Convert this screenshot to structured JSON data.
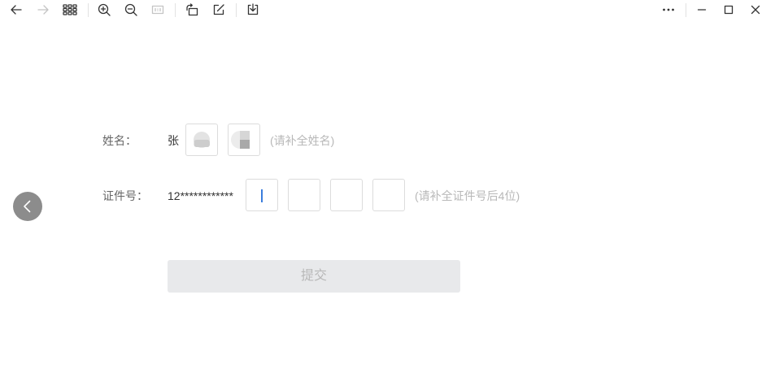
{
  "toolbar": {
    "left": [
      {
        "icon": "arrow-left-icon",
        "enabled": true
      },
      {
        "icon": "arrow-right-icon",
        "enabled": false
      },
      {
        "icon": "grid-icon",
        "enabled": true
      },
      {
        "icon": "zoom-in-icon",
        "enabled": true
      },
      {
        "icon": "zoom-out-icon",
        "enabled": true
      },
      {
        "icon": "actual-size-icon",
        "enabled": false
      },
      {
        "icon": "rotate-icon",
        "enabled": true
      },
      {
        "icon": "edit-icon",
        "enabled": true
      },
      {
        "icon": "download-icon",
        "enabled": true
      }
    ],
    "right": [
      {
        "icon": "more-icon",
        "enabled": true
      },
      {
        "icon": "minimize-icon",
        "enabled": true
      },
      {
        "icon": "maximize-icon",
        "enabled": true
      },
      {
        "icon": "close-icon",
        "enabled": true
      }
    ]
  },
  "nav": {
    "prev_icon": "chevron-left-icon"
  },
  "form": {
    "name": {
      "label": "姓名：",
      "known_part": "张",
      "hint": "(请补全姓名)"
    },
    "id_number": {
      "label": "证件号：",
      "known_part": "12************",
      "inputs": [
        "",
        "",
        "",
        ""
      ],
      "hint": "(请补全证件号后4位)"
    },
    "submit": {
      "label": "提交",
      "enabled": false
    }
  },
  "colors": {
    "accent": "#3b7ddd",
    "text": "#333333",
    "label": "#666666",
    "hint": "#b8b8b8",
    "border": "#dcdcdc",
    "button_bg": "#e8e9eb",
    "button_text": "#b8b8b8",
    "nav_bg": "#8c8c8c"
  }
}
